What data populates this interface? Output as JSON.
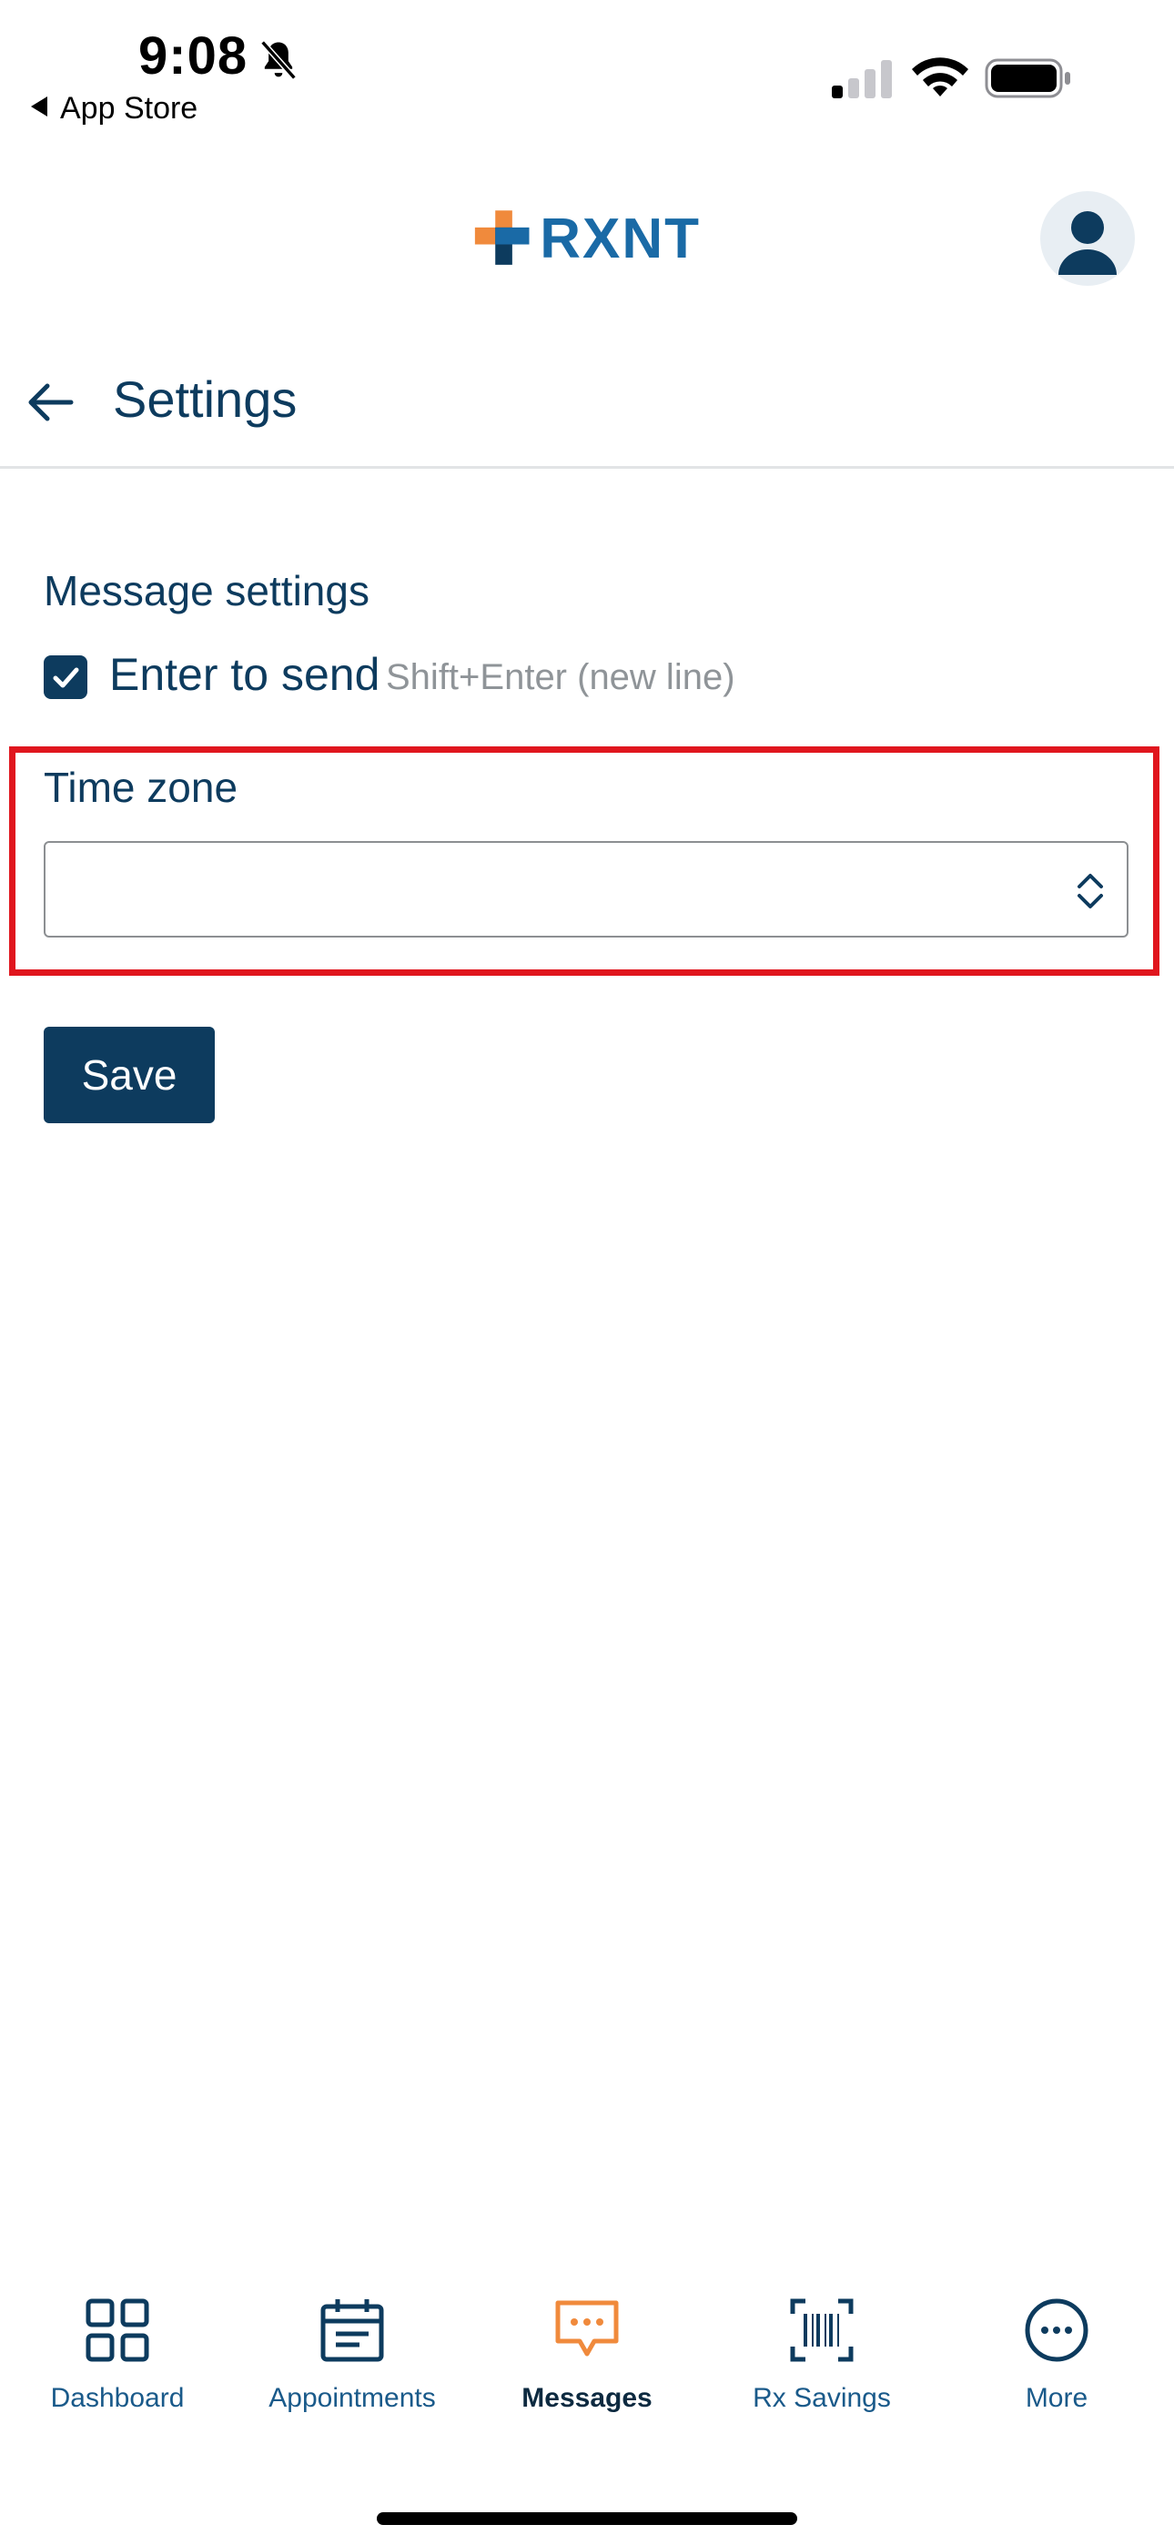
{
  "status_bar": {
    "time": "9:08",
    "back_app_label": "App Store"
  },
  "header": {
    "logo_text": "RXNT",
    "brand_colors": {
      "primary": "#0d3b5e",
      "accent_orange": "#f08a3c",
      "logo_blue": "#1a6aa6"
    }
  },
  "page": {
    "title": "Settings"
  },
  "message_settings": {
    "section_title": "Message settings",
    "enter_to_send_label": "Enter to send",
    "enter_to_send_hint": "Shift+Enter (new line)",
    "enter_to_send_checked": true
  },
  "time_zone": {
    "label": "Time zone",
    "selected_value": ""
  },
  "actions": {
    "save_label": "Save"
  },
  "bottom_nav": {
    "items": [
      {
        "label": "Dashboard",
        "icon": "dashboard-icon",
        "active": false
      },
      {
        "label": "Appointments",
        "icon": "calendar-icon",
        "active": false
      },
      {
        "label": "Messages",
        "icon": "message-icon",
        "active": true
      },
      {
        "label": "Rx Savings",
        "icon": "barcode-icon",
        "active": false
      },
      {
        "label": "More",
        "icon": "more-icon",
        "active": false
      }
    ]
  },
  "highlight_color": "#e0161e"
}
